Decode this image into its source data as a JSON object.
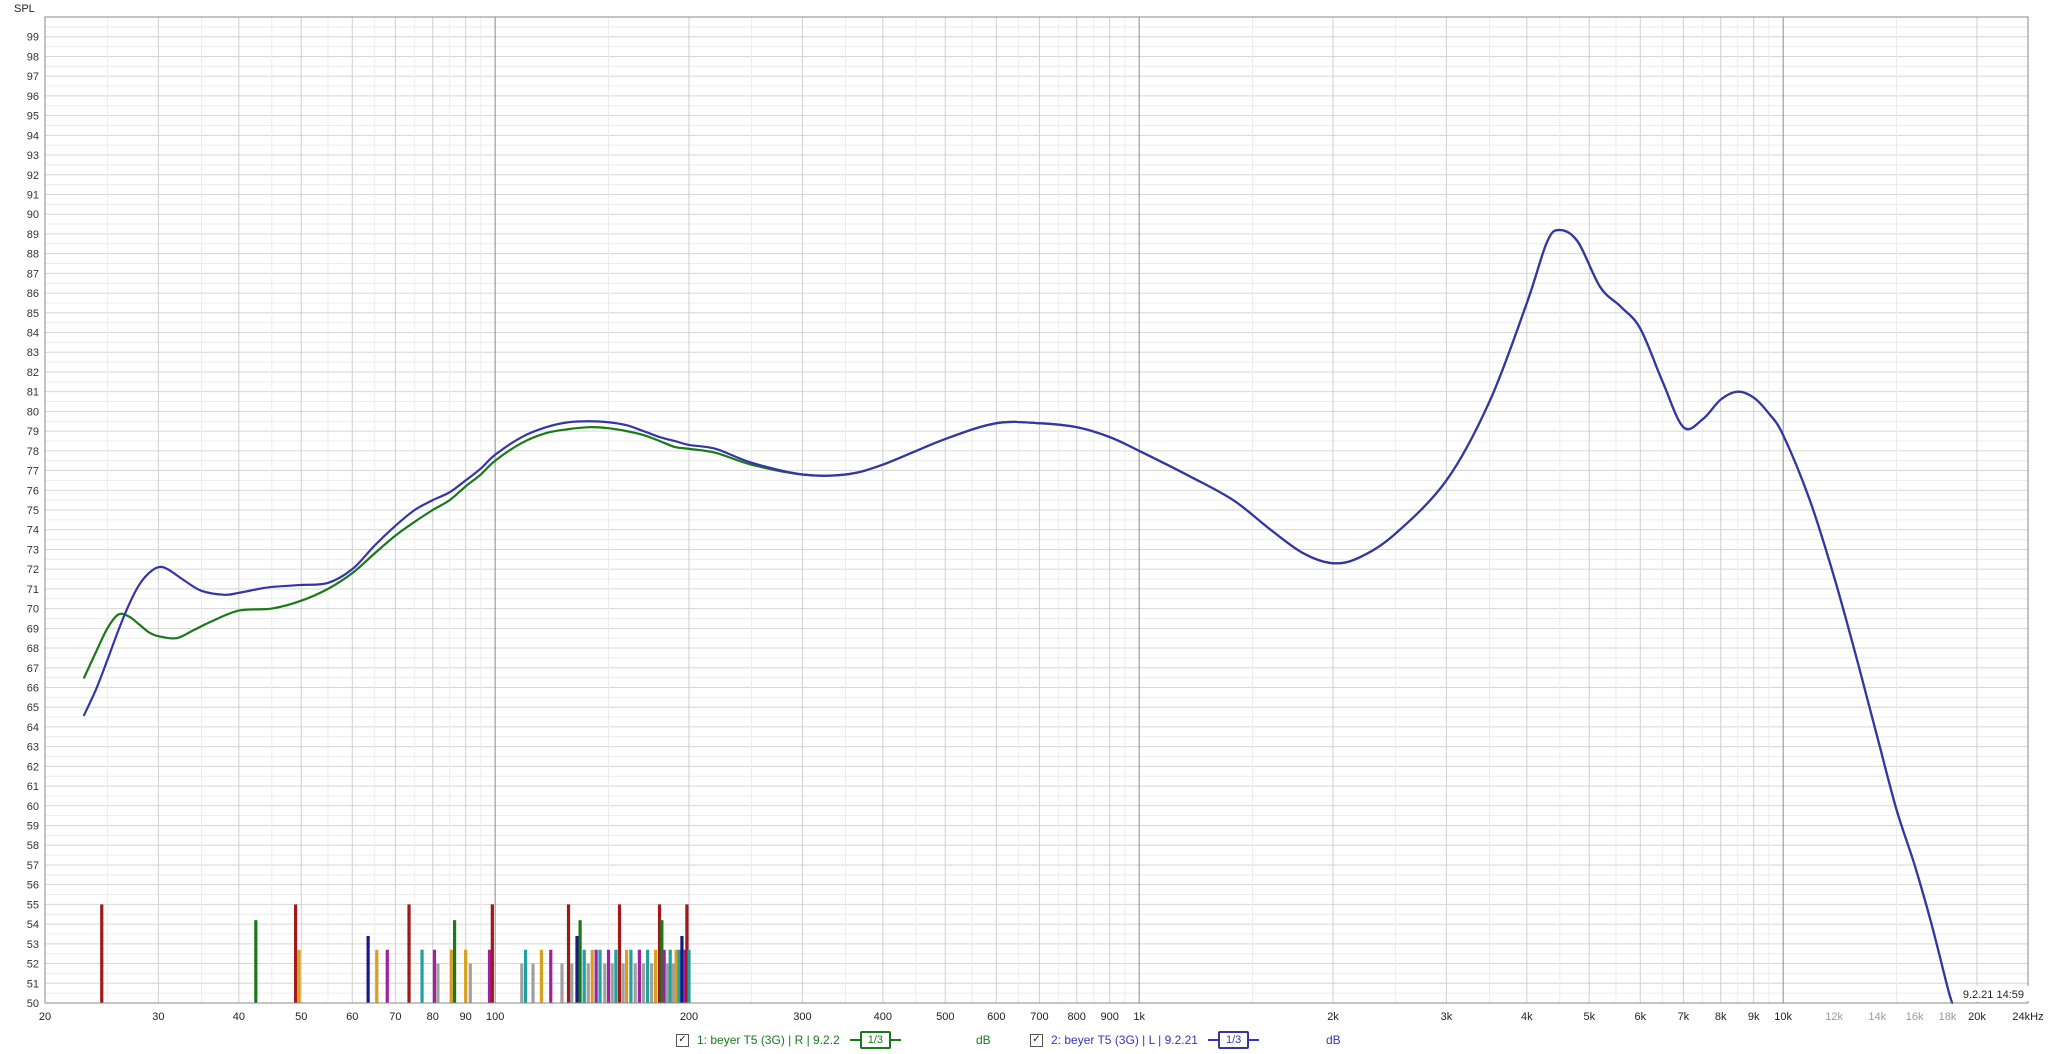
{
  "app": {
    "y_axis_title": "SPL",
    "timestamp": "9.2.21 14:59"
  },
  "chart_data": {
    "type": "line",
    "xscale": "log",
    "xlim": [
      20,
      24000
    ],
    "ylim": [
      50,
      100
    ],
    "x_ticks": [
      {
        "v": 20,
        "label": "20"
      },
      {
        "v": 30,
        "label": "30"
      },
      {
        "v": 40,
        "label": "40"
      },
      {
        "v": 50,
        "label": "50"
      },
      {
        "v": 60,
        "label": "60"
      },
      {
        "v": 70,
        "label": "70"
      },
      {
        "v": 80,
        "label": "80"
      },
      {
        "v": 90,
        "label": "90"
      },
      {
        "v": 100,
        "label": "100"
      },
      {
        "v": 200,
        "label": "200"
      },
      {
        "v": 300,
        "label": "300"
      },
      {
        "v": 400,
        "label": "400"
      },
      {
        "v": 500,
        "label": "500"
      },
      {
        "v": 600,
        "label": "600"
      },
      {
        "v": 700,
        "label": "700"
      },
      {
        "v": 800,
        "label": "800"
      },
      {
        "v": 900,
        "label": "900"
      },
      {
        "v": 1000,
        "label": "1k"
      },
      {
        "v": 2000,
        "label": "2k"
      },
      {
        "v": 3000,
        "label": "3k"
      },
      {
        "v": 4000,
        "label": "4k"
      },
      {
        "v": 5000,
        "label": "5k"
      },
      {
        "v": 6000,
        "label": "6k"
      },
      {
        "v": 7000,
        "label": "7k"
      },
      {
        "v": 8000,
        "label": "8k"
      },
      {
        "v": 9000,
        "label": "9k"
      },
      {
        "v": 10000,
        "label": "10k"
      },
      {
        "v": 12000,
        "label": "12k",
        "muted": true
      },
      {
        "v": 14000,
        "label": "14k",
        "muted": true
      },
      {
        "v": 16000,
        "label": "16k",
        "muted": true
      },
      {
        "v": 18000,
        "label": "18k",
        "muted": true
      },
      {
        "v": 20000,
        "label": "20k"
      },
      {
        "v": 24000,
        "label": "24kHz"
      }
    ],
    "y_tick_labels": [
      "50",
      "51",
      "52",
      "53",
      "54",
      "55",
      "56",
      "57",
      "58",
      "59",
      "60",
      "61",
      "62",
      "63",
      "64",
      "65",
      "66",
      "67",
      "68",
      "69",
      "70",
      "71",
      "72",
      "73",
      "74",
      "75",
      "76",
      "77",
      "78",
      "79",
      "80",
      "81",
      "82",
      "83",
      "84",
      "85",
      "86",
      "87",
      "88",
      "89",
      "90",
      "91",
      "92",
      "93",
      "94",
      "95",
      "96",
      "97",
      "98",
      "99"
    ],
    "grid": true,
    "series": [
      {
        "name": "1: beyer T5 (3G) | R | 9.2.2",
        "color": "#1a7a1a",
        "points": [
          [
            23,
            66.5
          ],
          [
            24,
            67.8
          ],
          [
            25,
            69.0
          ],
          [
            26,
            69.7
          ],
          [
            27,
            69.6
          ],
          [
            28,
            69.2
          ],
          [
            29,
            68.8
          ],
          [
            30,
            68.6
          ],
          [
            32,
            68.5
          ],
          [
            34,
            68.9
          ],
          [
            36,
            69.3
          ],
          [
            40,
            69.9
          ],
          [
            45,
            70.0
          ],
          [
            50,
            70.4
          ],
          [
            55,
            71.0
          ],
          [
            60,
            71.8
          ],
          [
            65,
            72.8
          ],
          [
            70,
            73.7
          ],
          [
            75,
            74.4
          ],
          [
            80,
            75.0
          ],
          [
            85,
            75.5
          ],
          [
            90,
            76.2
          ],
          [
            95,
            76.8
          ],
          [
            100,
            77.5
          ],
          [
            110,
            78.4
          ],
          [
            120,
            78.9
          ],
          [
            130,
            79.1
          ],
          [
            140,
            79.2
          ],
          [
            150,
            79.15
          ],
          [
            160,
            79.0
          ],
          [
            170,
            78.8
          ],
          [
            180,
            78.5
          ],
          [
            190,
            78.2
          ],
          [
            200,
            78.1
          ],
          [
            220,
            77.9
          ],
          [
            250,
            77.3
          ],
          [
            300,
            76.8
          ],
          [
            350,
            76.8
          ],
          [
            400,
            77.3
          ],
          [
            500,
            78.6
          ],
          [
            600,
            79.4
          ],
          [
            700,
            79.4
          ],
          [
            800,
            79.2
          ],
          [
            900,
            78.7
          ],
          [
            1000,
            78.0
          ],
          [
            1200,
            76.7
          ],
          [
            1400,
            75.5
          ],
          [
            1600,
            74.0
          ],
          [
            1800,
            72.8
          ],
          [
            2000,
            72.3
          ],
          [
            2200,
            72.6
          ],
          [
            2500,
            73.8
          ],
          [
            3000,
            76.5
          ],
          [
            3500,
            80.5
          ],
          [
            4000,
            85.5
          ],
          [
            4300,
            88.6
          ],
          [
            4500,
            89.2
          ],
          [
            4800,
            88.6
          ],
          [
            5200,
            86.3
          ],
          [
            5600,
            85.3
          ],
          [
            6000,
            84.2
          ],
          [
            6500,
            81.5
          ],
          [
            7000,
            79.2
          ],
          [
            7500,
            79.6
          ],
          [
            8000,
            80.6
          ],
          [
            8500,
            81.0
          ],
          [
            9000,
            80.7
          ],
          [
            9500,
            79.9
          ],
          [
            10000,
            78.8
          ],
          [
            11000,
            75.5
          ],
          [
            12000,
            71.6
          ],
          [
            13000,
            67.5
          ],
          [
            14000,
            63.5
          ],
          [
            15000,
            59.8
          ],
          [
            16000,
            57.0
          ],
          [
            17000,
            54.0
          ],
          [
            18000,
            50.8
          ],
          [
            18300,
            50.0
          ]
        ]
      },
      {
        "name": "2: beyer T5 (3G) | L | 9.2.21",
        "color": "#3535a8",
        "points": [
          [
            23,
            64.6
          ],
          [
            24,
            65.9
          ],
          [
            25,
            67.4
          ],
          [
            26,
            68.9
          ],
          [
            27,
            70.2
          ],
          [
            28,
            71.2
          ],
          [
            29,
            71.8
          ],
          [
            30,
            72.1
          ],
          [
            31,
            72.0
          ],
          [
            33,
            71.4
          ],
          [
            35,
            70.9
          ],
          [
            38,
            70.7
          ],
          [
            40,
            70.8
          ],
          [
            43,
            71.0
          ],
          [
            45,
            71.1
          ],
          [
            50,
            71.2
          ],
          [
            55,
            71.3
          ],
          [
            60,
            72.0
          ],
          [
            65,
            73.2
          ],
          [
            70,
            74.2
          ],
          [
            75,
            75.0
          ],
          [
            80,
            75.5
          ],
          [
            85,
            75.9
          ],
          [
            90,
            76.5
          ],
          [
            95,
            77.1
          ],
          [
            100,
            77.8
          ],
          [
            110,
            78.7
          ],
          [
            120,
            79.2
          ],
          [
            130,
            79.45
          ],
          [
            140,
            79.5
          ],
          [
            150,
            79.45
          ],
          [
            160,
            79.3
          ],
          [
            170,
            79.0
          ],
          [
            180,
            78.7
          ],
          [
            190,
            78.5
          ],
          [
            200,
            78.3
          ],
          [
            220,
            78.1
          ],
          [
            250,
            77.4
          ],
          [
            300,
            76.8
          ],
          [
            350,
            76.8
          ],
          [
            400,
            77.3
          ],
          [
            500,
            78.6
          ],
          [
            600,
            79.4
          ],
          [
            700,
            79.4
          ],
          [
            800,
            79.2
          ],
          [
            900,
            78.7
          ],
          [
            1000,
            78.0
          ],
          [
            1200,
            76.7
          ],
          [
            1400,
            75.5
          ],
          [
            1600,
            74.0
          ],
          [
            1800,
            72.8
          ],
          [
            2000,
            72.3
          ],
          [
            2200,
            72.6
          ],
          [
            2500,
            73.8
          ],
          [
            3000,
            76.5
          ],
          [
            3500,
            80.5
          ],
          [
            4000,
            85.5
          ],
          [
            4300,
            88.6
          ],
          [
            4500,
            89.2
          ],
          [
            4800,
            88.6
          ],
          [
            5200,
            86.3
          ],
          [
            5600,
            85.3
          ],
          [
            6000,
            84.2
          ],
          [
            6500,
            81.5
          ],
          [
            7000,
            79.2
          ],
          [
            7500,
            79.6
          ],
          [
            8000,
            80.6
          ],
          [
            8500,
            81.0
          ],
          [
            9000,
            80.7
          ],
          [
            9500,
            79.9
          ],
          [
            10000,
            78.8
          ],
          [
            11000,
            75.5
          ],
          [
            12000,
            71.6
          ],
          [
            13000,
            67.5
          ],
          [
            14000,
            63.5
          ],
          [
            15000,
            59.8
          ],
          [
            16000,
            57.0
          ],
          [
            17000,
            54.0
          ],
          [
            18000,
            50.8
          ],
          [
            18300,
            50.0
          ]
        ]
      }
    ],
    "peak_markers": [
      {
        "f": 24.5,
        "top": 55,
        "color": "#a01818"
      },
      {
        "f": 42.5,
        "top": 54.2,
        "color": "#1a7a1a"
      },
      {
        "f": 49.0,
        "top": 55,
        "color": "#a01818"
      },
      {
        "f": 49.6,
        "top": 52.7,
        "color": "#d9a020"
      },
      {
        "f": 63.5,
        "top": 53.4,
        "color": "#1a1a80"
      },
      {
        "f": 65.5,
        "top": 52.7,
        "color": "#d9a020"
      },
      {
        "f": 68.0,
        "top": 52.7,
        "color": "#a020a0"
      },
      {
        "f": 73.5,
        "top": 55,
        "color": "#a01818"
      },
      {
        "f": 77.0,
        "top": 52.7,
        "color": "#20a0a0"
      },
      {
        "f": 80.5,
        "top": 52.7,
        "color": "#a020a0"
      },
      {
        "f": 81.5,
        "top": 52.0,
        "color": "#a0a0a0"
      },
      {
        "f": 85.5,
        "top": 52.7,
        "color": "#d9a020"
      },
      {
        "f": 86.5,
        "top": 54.2,
        "color": "#1a7a1a"
      },
      {
        "f": 90.0,
        "top": 52.7,
        "color": "#d9a020"
      },
      {
        "f": 91.5,
        "top": 52.0,
        "color": "#a0a0a0"
      },
      {
        "f": 98.0,
        "top": 52.7,
        "color": "#a020a0"
      },
      {
        "f": 99.0,
        "top": 55,
        "color": "#a01818"
      },
      {
        "f": 110.0,
        "top": 52.0,
        "color": "#a0a0a0"
      },
      {
        "f": 111.5,
        "top": 52.7,
        "color": "#20a0a0"
      },
      {
        "f": 114.5,
        "top": 52.0,
        "color": "#a0a0a0"
      },
      {
        "f": 118.0,
        "top": 52.7,
        "color": "#d9a020"
      },
      {
        "f": 122.0,
        "top": 52.7,
        "color": "#a020a0"
      },
      {
        "f": 127.0,
        "top": 52.0,
        "color": "#a0a0a0"
      },
      {
        "f": 130.0,
        "top": 55,
        "color": "#a01818"
      },
      {
        "f": 131.5,
        "top": 52.0,
        "color": "#a0a0a0"
      },
      {
        "f": 134.0,
        "top": 53.4,
        "color": "#1a1a80"
      },
      {
        "f": 135.5,
        "top": 54.2,
        "color": "#1a7a1a"
      },
      {
        "f": 137.5,
        "top": 52.7,
        "color": "#20a0a0"
      },
      {
        "f": 139.5,
        "top": 52.0,
        "color": "#a0a0a0"
      },
      {
        "f": 141.5,
        "top": 52.7,
        "color": "#d9a020"
      },
      {
        "f": 143.5,
        "top": 52.7,
        "color": "#a020a0"
      },
      {
        "f": 145.5,
        "top": 52.7,
        "color": "#20a0a0"
      },
      {
        "f": 148.0,
        "top": 52.0,
        "color": "#a0a0a0"
      },
      {
        "f": 150.0,
        "top": 52.7,
        "color": "#a020a0"
      },
      {
        "f": 152.0,
        "top": 52.0,
        "color": "#a0a0a0"
      },
      {
        "f": 154.0,
        "top": 52.7,
        "color": "#20a0a0"
      },
      {
        "f": 156.0,
        "top": 55,
        "color": "#a01818"
      },
      {
        "f": 158.0,
        "top": 52.0,
        "color": "#a0a0a0"
      },
      {
        "f": 160.0,
        "top": 52.7,
        "color": "#d9a020"
      },
      {
        "f": 162.5,
        "top": 52.7,
        "color": "#20a0a0"
      },
      {
        "f": 165.0,
        "top": 52.0,
        "color": "#a0a0a0"
      },
      {
        "f": 167.5,
        "top": 52.7,
        "color": "#a020a0"
      },
      {
        "f": 170.0,
        "top": 52.0,
        "color": "#a0a0a0"
      },
      {
        "f": 172.5,
        "top": 52.7,
        "color": "#20a0a0"
      },
      {
        "f": 175.0,
        "top": 52.0,
        "color": "#a0a0a0"
      },
      {
        "f": 177.5,
        "top": 52.7,
        "color": "#d9a020"
      },
      {
        "f": 180.0,
        "top": 55,
        "color": "#a01818"
      },
      {
        "f": 181.5,
        "top": 54.2,
        "color": "#1a7a1a"
      },
      {
        "f": 183.0,
        "top": 52.7,
        "color": "#a020a0"
      },
      {
        "f": 185.0,
        "top": 52.0,
        "color": "#a0a0a0"
      },
      {
        "f": 187.0,
        "top": 52.7,
        "color": "#20a0a0"
      },
      {
        "f": 189.0,
        "top": 52.0,
        "color": "#a0a0a0"
      },
      {
        "f": 191.0,
        "top": 52.7,
        "color": "#d9a020"
      },
      {
        "f": 193.0,
        "top": 52.7,
        "color": "#20a0a0"
      },
      {
        "f": 195.0,
        "top": 53.4,
        "color": "#1a1a80"
      },
      {
        "f": 197.0,
        "top": 52.7,
        "color": "#a020a0"
      },
      {
        "f": 198.5,
        "top": 55,
        "color": "#a01818"
      },
      {
        "f": 200.0,
        "top": 52.7,
        "color": "#20a0a0"
      }
    ]
  },
  "legend": {
    "items": [
      {
        "checkbox_mark": "✓",
        "label": "1: beyer T5 (3G) | R | 9.2.2",
        "smoothing": "1/3",
        "unit": "dB",
        "color": "#1a7a1a"
      },
      {
        "checkbox_mark": "✓",
        "label": "2: beyer T5 (3G) | L | 9.2.21",
        "smoothing": "1/3",
        "unit": "dB",
        "color": "#3535c0"
      }
    ]
  }
}
